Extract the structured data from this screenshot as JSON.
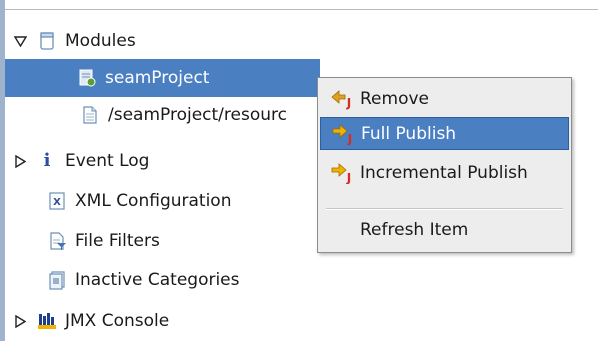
{
  "tree": {
    "items": [
      {
        "label": "Modules",
        "icon": "folder-icon"
      },
      {
        "label": "seamProject",
        "icon": "project-module-icon"
      },
      {
        "label": "/seamProject/resourc",
        "icon": "file-resource-icon"
      },
      {
        "label": "Event Log",
        "icon": "info-icon"
      },
      {
        "label": "XML Configuration",
        "icon": "xml-file-icon"
      },
      {
        "label": "File Filters",
        "icon": "file-filter-icon"
      },
      {
        "label": "Inactive Categories",
        "icon": "inactive-categories-icon"
      },
      {
        "label": "JMX Console",
        "icon": "jmx-console-icon"
      }
    ]
  },
  "context_menu": {
    "items": [
      {
        "label": "Remove",
        "icon": "remove-icon"
      },
      {
        "label": "Full Publish",
        "icon": "full-publish-icon"
      },
      {
        "label": "Incremental Publish",
        "icon": "incremental-publish-icon"
      },
      {
        "label": "Refresh Item"
      }
    ]
  },
  "colors": {
    "selection": "#4a7fc2",
    "menu_background": "#ededed",
    "left_border": "#9fb3cc"
  }
}
